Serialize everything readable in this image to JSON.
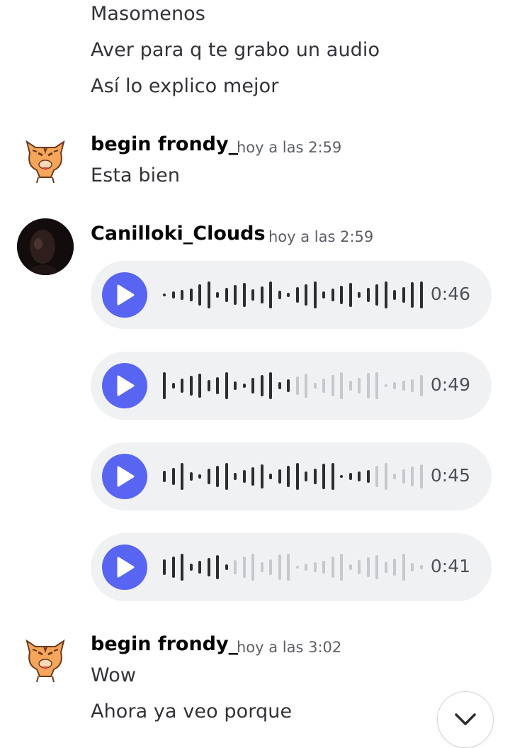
{
  "top_messages": [
    "Masomenos",
    "Aver para q te grabo un audio",
    "Así lo explico mejor"
  ],
  "group1": {
    "username": "begin frondy_",
    "timestamp": "hoy a las 2:59",
    "messages": [
      "Esta bien"
    ]
  },
  "group2": {
    "username": "Canilloki_Clouds",
    "timestamp": "hoy a las 2:59",
    "voice_messages": [
      {
        "duration": "0:46",
        "progress": 1.0
      },
      {
        "duration": "0:49",
        "progress": 0.5
      },
      {
        "duration": "0:45",
        "progress": 0.8
      },
      {
        "duration": "0:41",
        "progress": 0.25
      }
    ]
  },
  "group3": {
    "username": "begin frondy_",
    "timestamp": "hoy a las 3:02",
    "messages": [
      "Wow",
      "Ahora ya veo porque"
    ]
  },
  "icons": {
    "play": "play-icon",
    "scroll": "chevron-down-icon"
  },
  "colors": {
    "accent": "#5865f2",
    "wave_played": "#2b2d31",
    "wave_unplayed": "#c4c9ce",
    "voice_bg": "#f0f1f3"
  }
}
